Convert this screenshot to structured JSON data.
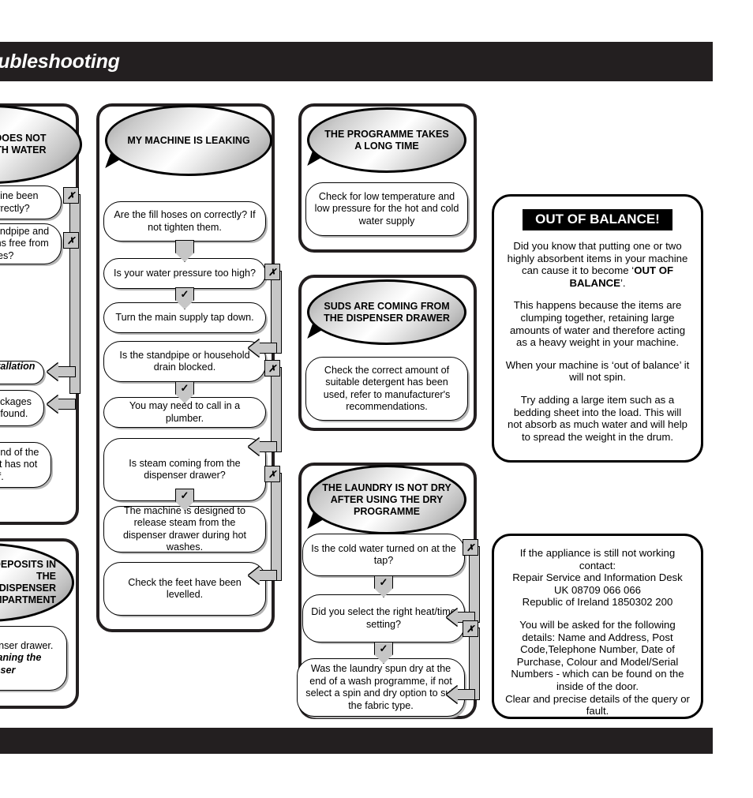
{
  "page": {
    "header_title": "Troubleshooting",
    "footer": ""
  },
  "columns": {
    "col_fill": {
      "bubble": "MY MACHINE DOES NOT FILL WITH WATER",
      "bubble_visible": "OES NOT\nATER",
      "steps": [
        {
          "text": "Has the machine been installed correctly?",
          "visible": "een installed\n?"
        },
        {
          "text": "Are the inlet, standpipe and drain connections free from blockages?",
          "visible": "t, standpipe\nections free\nges?"
        },
        {
          "text": "Refer to the Installation section.",
          "visible": "allation"
        },
        {
          "text": "Remove any blockages that have been found.",
          "visible": "s that have\nd"
        },
        {
          "text": "Check that the end of the power cable unit has not come off.",
          "visible": "end of the\ne unit has\nff."
        }
      ]
    },
    "col_dispenser": {
      "bubble": "THERE ARE DEPOSITS IN THE DISPENSER COMPARTMENT",
      "bubble_visible": "TS IN THE\nENSER\nENT",
      "steps": [
        {
          "text": "Clean the dispenser drawer. Refer to Cleaning the Dispenser Drawer.",
          "visible": "ser drawer.\nDispenser"
        }
      ]
    },
    "col_leaking": {
      "bubble": "MY MACHINE IS LEAKING",
      "steps": [
        {
          "text": "Are the fill hoses on correctly? If not tighten them."
        },
        {
          "text": "Is your water pressure too high?"
        },
        {
          "text": "Turn the main supply tap down."
        },
        {
          "text": "Is the standpipe or household drain blocked."
        },
        {
          "text": "You may need to call in a plumber."
        },
        {
          "text": "Is steam coming from the dispenser drawer?"
        },
        {
          "text": "The machine is designed to release steam from the dispenser drawer during hot washes."
        },
        {
          "text": "Check the feet have been levelled."
        }
      ]
    },
    "col_longtime": {
      "bubble": "THE PROGRAMME TAKES A LONG TIME",
      "steps": [
        {
          "text": "Check for low temperature and low pressure for the hot and cold water supply"
        }
      ]
    },
    "col_suds": {
      "bubble": "SUDS ARE COMING FROM THE DISPENSER DRAWER",
      "steps": [
        {
          "text": "Check the correct amount of suitable detergent has been used, refer to manufacturer's recommendations."
        }
      ]
    },
    "col_notdry": {
      "bubble": "THE LAUNDRY IS NOT DRY AFTER USING THE DRY PROGRAMME",
      "steps": [
        {
          "text": "Is the cold water turned on at the tap?"
        },
        {
          "text": "Did you select the right heat/time setting?"
        },
        {
          "text": "Was the laundry spun dry at the end of a wash programme, if not select a spin and dry option to suit the fabric type."
        }
      ]
    }
  },
  "panels": {
    "out_of_balance": {
      "title": "OUT OF BALANCE!",
      "para1_a": "Did you know that putting one or two highly absorbent items in your machine can cause it to become ",
      "para1_quote_open": "‘",
      "para1_bold": "OUT OF BALANCE",
      "para1_quote_close": "’.",
      "para2": "This happens because the items are clumping together, retaining large amounts of water and therefore acting as a heavy weight in your machine.",
      "para3": "When your machine is ‘out of balance’ it will not spin.",
      "para4": "Try adding a large item such as a bedding sheet into the load.  This will not absorb as much water and will help to spread the weight in the drum."
    },
    "contact": {
      "para1": "If the appliance is still not working contact:\nRepair Service and Information Desk\nUK 08709 066 066\nRepublic of Ireland 1850302 200",
      "para2": "You will be asked for the following details: Name and Address, Post Code,Telephone Number, Date of Purchase, Colour and Model/Serial Numbers - which can be found on the inside of the door.\nClear and precise details of the query or fault."
    }
  },
  "markers": {
    "fail": "✗",
    "pass": "✓"
  }
}
